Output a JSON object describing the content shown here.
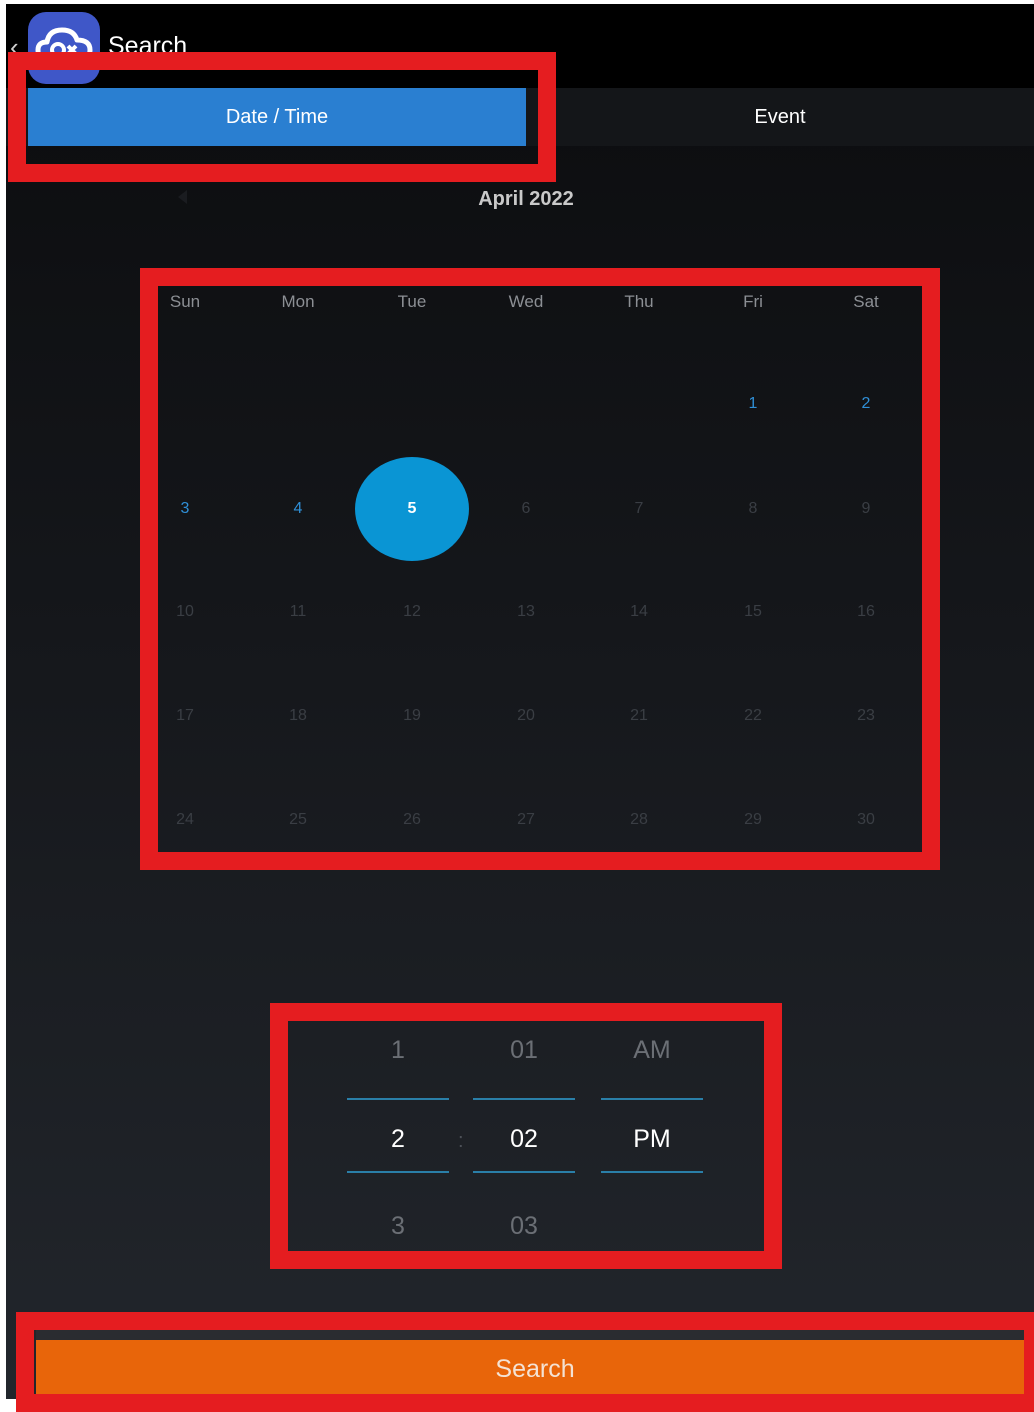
{
  "app": {
    "title": "Search"
  },
  "tabs": [
    {
      "label": "Date / Time",
      "active": true
    },
    {
      "label": "Event",
      "active": false
    }
  ],
  "calendar": {
    "month_title": "April 2022",
    "weekdays": [
      "Sun",
      "Mon",
      "Tue",
      "Wed",
      "Thu",
      "Fri",
      "Sat"
    ],
    "first_weekday_index": 5,
    "days_in_month": 30,
    "available_days": [
      1,
      2,
      3,
      4
    ],
    "selected_day": 5
  },
  "time_picker": {
    "hour": {
      "above": "1",
      "selected": "2",
      "below": "3"
    },
    "minute": {
      "above": "01",
      "selected": "02",
      "below": "03"
    },
    "period": {
      "above": "AM",
      "selected": "PM",
      "below": ""
    },
    "separator": ":"
  },
  "search_button": {
    "label": "Search"
  },
  "colors": {
    "tab_active": "#2a7fd1",
    "selected_day": "#0a95d4",
    "available_day": "#2f8fd6",
    "search_button": "#e8650a",
    "highlight": "#e51d20"
  }
}
